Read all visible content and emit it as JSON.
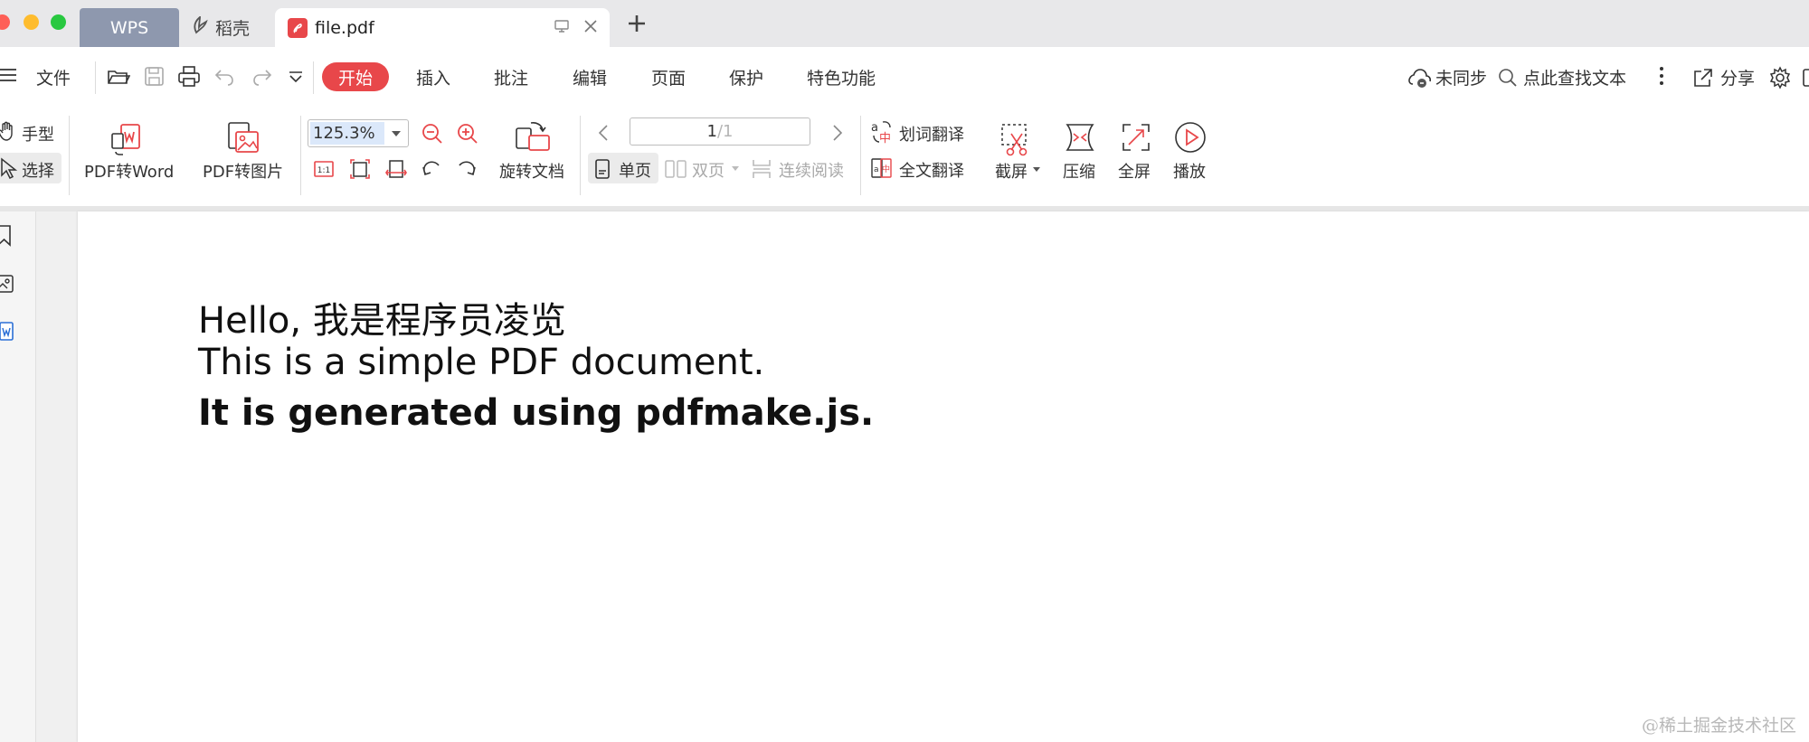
{
  "tabs": [
    {
      "label": "WPS"
    },
    {
      "label": "稻壳"
    },
    {
      "label": "file.pdf"
    }
  ],
  "menu": {
    "file": "文件",
    "items": [
      "开始",
      "插入",
      "批注",
      "编辑",
      "页面",
      "保护",
      "特色功能"
    ],
    "active": "开始",
    "sync": "未同步",
    "search": "点此查找文本",
    "share": "分享"
  },
  "ribbon": {
    "hand": "手型",
    "select": "选择",
    "pdf_to_word": "PDF转Word",
    "pdf_to_image": "PDF转图片",
    "zoom": "125.3%",
    "rotate_doc": "旋转文档",
    "page_current": "1",
    "page_total": "/1",
    "single_page": "单页",
    "double_page": "双页",
    "continuous": "连续阅读",
    "word_translate": "划词翻译",
    "full_translate": "全文翻译",
    "screenshot": "截屏",
    "compress": "压缩",
    "fullscreen": "全屏",
    "play": "播放"
  },
  "document": {
    "lines": [
      "Hello, 我是程序员凌览",
      "This is a simple PDF document.",
      "It is generated using pdfmake.js."
    ]
  },
  "watermark": "@稀土掘金技术社区",
  "colors": {
    "accent": "#e8474a",
    "tab_inactive": "#8e98ae",
    "titlebar": "#e8e8ea"
  }
}
